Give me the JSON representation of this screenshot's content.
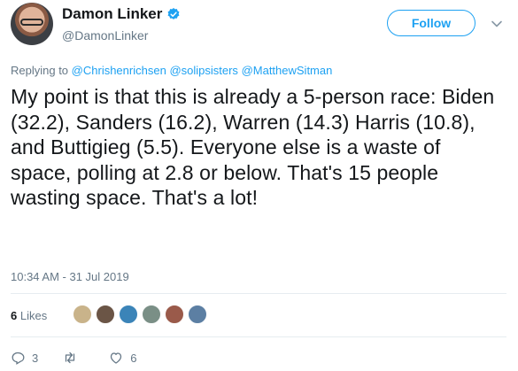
{
  "author": {
    "display_name": "Damon Linker",
    "handle": "@DamonLinker",
    "avatar_icon": "user-avatar-photo",
    "verified_icon": "verified-badge-icon"
  },
  "follow_label": "Follow",
  "reply_prefix": "Replying to",
  "reply_mentions": [
    "@Chrishenrichsen",
    "@solipsisters",
    "@MatthewSitman"
  ],
  "tweet_text": "My point is that this is already a 5-person race: Biden (32.2), Sanders (16.2), Warren (14.3) Harris (10.8), and Buttigieg (5.5). Everyone else is a waste of space, polling at 2.8 or below. That's 15 people wasting space. That's a lot!",
  "timestamp": "10:34 AM - 31 Jul 2019",
  "likes": {
    "count": "6",
    "label": "Likes"
  },
  "likers": [
    {
      "color": "#c9b38a"
    },
    {
      "color": "#6b5546"
    },
    {
      "color": "#3b84b8"
    },
    {
      "color": "#7a8f86"
    },
    {
      "color": "#9a5a4a"
    },
    {
      "color": "#5c7fa3"
    }
  ],
  "actions": {
    "replies": "3",
    "retweets": "",
    "likes": "6"
  },
  "colors": {
    "accent": "#1da1f2",
    "muted": "#657786"
  }
}
